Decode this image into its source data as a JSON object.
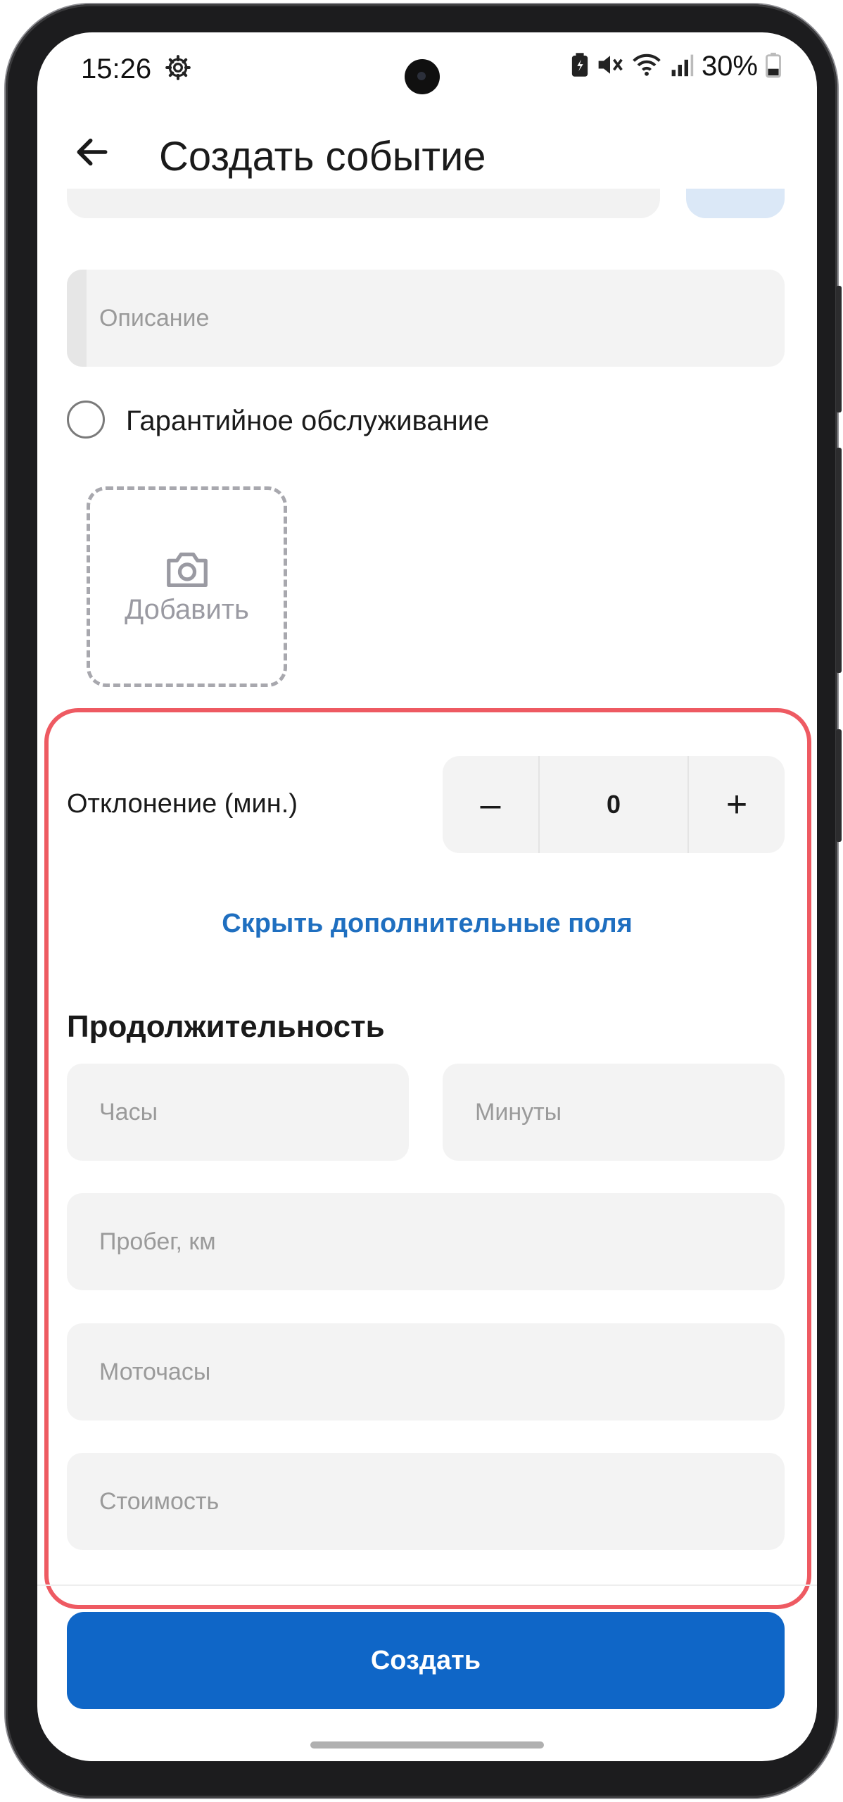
{
  "status_bar": {
    "time": "15:26",
    "battery_percent": "30%",
    "icons": [
      "gear-icon",
      "battery-saver-icon",
      "mute-icon",
      "wifi-icon",
      "signal-icon",
      "battery-icon"
    ]
  },
  "header": {
    "title": "Создать событие",
    "back_icon": "arrow-left-icon"
  },
  "form": {
    "description_placeholder": "Описание",
    "warranty_label": "Гарантийное обслуживание",
    "warranty_checked": false,
    "photo_add_label": "Добавить",
    "deviation_label": "Отклонение (мин.)",
    "deviation_value": "0",
    "decrement_label": "–",
    "increment_label": "+",
    "hide_fields_link": "Скрыть дополнительные поля",
    "duration_title": "Продолжительность",
    "hours_placeholder": "Часы",
    "minutes_placeholder": "Минуты",
    "mileage_placeholder": "Пробег, км",
    "engine_hours_placeholder": "Моточасы",
    "cost_placeholder": "Стоимость"
  },
  "footer": {
    "create_button": "Создать"
  },
  "colors": {
    "accent": "#0f66c7",
    "link": "#1f6fc0",
    "highlight": "#ee5a62",
    "field_bg": "#f3f3f3"
  }
}
